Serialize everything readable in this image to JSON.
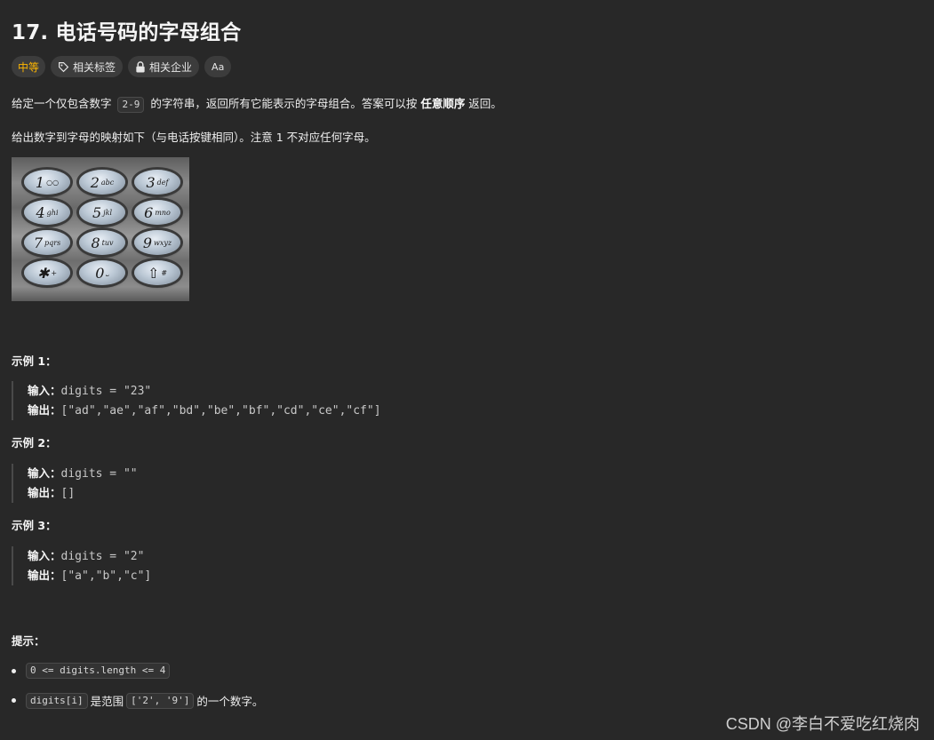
{
  "problem": {
    "title": "17. 电话号码的字母组合",
    "difficulty": "中等",
    "tags": [
      {
        "label": "相关标签",
        "icon": "tag-icon"
      },
      {
        "label": "相关企业",
        "icon": "lock-icon"
      },
      {
        "label": "Aa",
        "icon": "translate-icon"
      }
    ],
    "desc1_pre": "给定一个仅包含数字 ",
    "desc1_code": "2-9",
    "desc1_mid": " 的字符串，返回所有它能表示的字母组合。答案可以按 ",
    "desc1_bold": "任意顺序",
    "desc1_post": " 返回。",
    "desc2": "给出数字到字母的映射如下（与电话按键相同）。注意 1 不对应任何字母。"
  },
  "keypad": [
    {
      "digit": "1",
      "letters": "○○"
    },
    {
      "digit": "2",
      "letters": "abc"
    },
    {
      "digit": "3",
      "letters": "def"
    },
    {
      "digit": "4",
      "letters": "ghi"
    },
    {
      "digit": "5",
      "letters": "jkl"
    },
    {
      "digit": "6",
      "letters": "mno"
    },
    {
      "digit": "7",
      "letters": "pqrs"
    },
    {
      "digit": "8",
      "letters": "tuv"
    },
    {
      "digit": "9",
      "letters": "wxyz"
    },
    {
      "digit": "✱",
      "letters": "+"
    },
    {
      "digit": "0",
      "letters": "⎵"
    },
    {
      "digit": "⇧",
      "letters": "#"
    }
  ],
  "examples": [
    {
      "heading": "示例 1：",
      "input_label": "输入：",
      "input": "digits = \"23\"",
      "output_label": "输出：",
      "output": "[\"ad\",\"ae\",\"af\",\"bd\",\"be\",\"bf\",\"cd\",\"ce\",\"cf\"]"
    },
    {
      "heading": "示例 2：",
      "input_label": "输入：",
      "input": "digits = \"\"",
      "output_label": "输出：",
      "output": "[]"
    },
    {
      "heading": "示例 3：",
      "input_label": "输入：",
      "input": "digits = \"2\"",
      "output_label": "输出：",
      "output": "[\"a\",\"b\",\"c\"]"
    }
  ],
  "hints": {
    "heading": "提示：",
    "items": [
      {
        "code": "0 <= digits.length <= 4",
        "text": ""
      },
      {
        "code": "digits[i]",
        "text": " 是范围 ",
        "code2": "['2', '9']",
        "text2": " 的一个数字。"
      }
    ]
  },
  "watermark": "CSDN @李白不爱吃红烧肉",
  "colors": {
    "background": "#282828",
    "difficulty": "#ffb700",
    "tag_bg": "#3c3c3c"
  }
}
